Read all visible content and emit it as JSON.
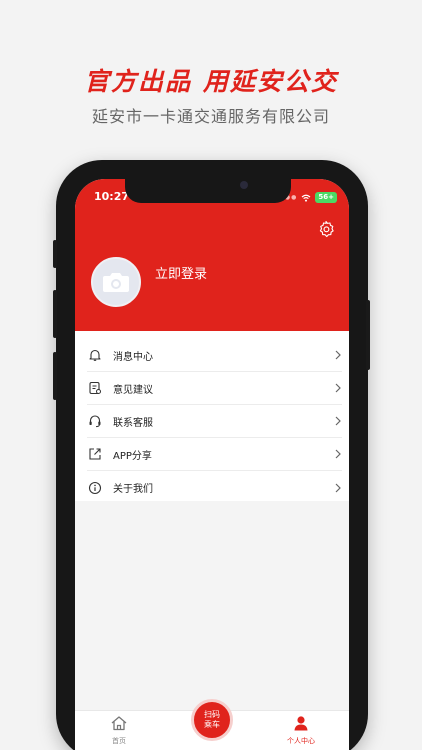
{
  "promo": {
    "title": "官方出品 用延安公交",
    "subtitle": "延安市一卡通交通服务有限公司"
  },
  "status_bar": {
    "time": "10:27",
    "battery": "56+"
  },
  "profile": {
    "login_text": "立即登录"
  },
  "menu": [
    {
      "label": "消息中心",
      "icon": "bell-icon"
    },
    {
      "label": "意见建议",
      "icon": "feedback-icon"
    },
    {
      "label": "联系客服",
      "icon": "headset-icon"
    },
    {
      "label": "APP分享",
      "icon": "share-icon"
    },
    {
      "label": "关于我们",
      "icon": "info-icon"
    }
  ],
  "bottom_nav": {
    "home": "首页",
    "scan_line1": "扫码",
    "scan_line2": "乘车",
    "profile": "个人中心"
  },
  "colors": {
    "brand_red": "#e0231c",
    "background": "#f3f3f3"
  }
}
